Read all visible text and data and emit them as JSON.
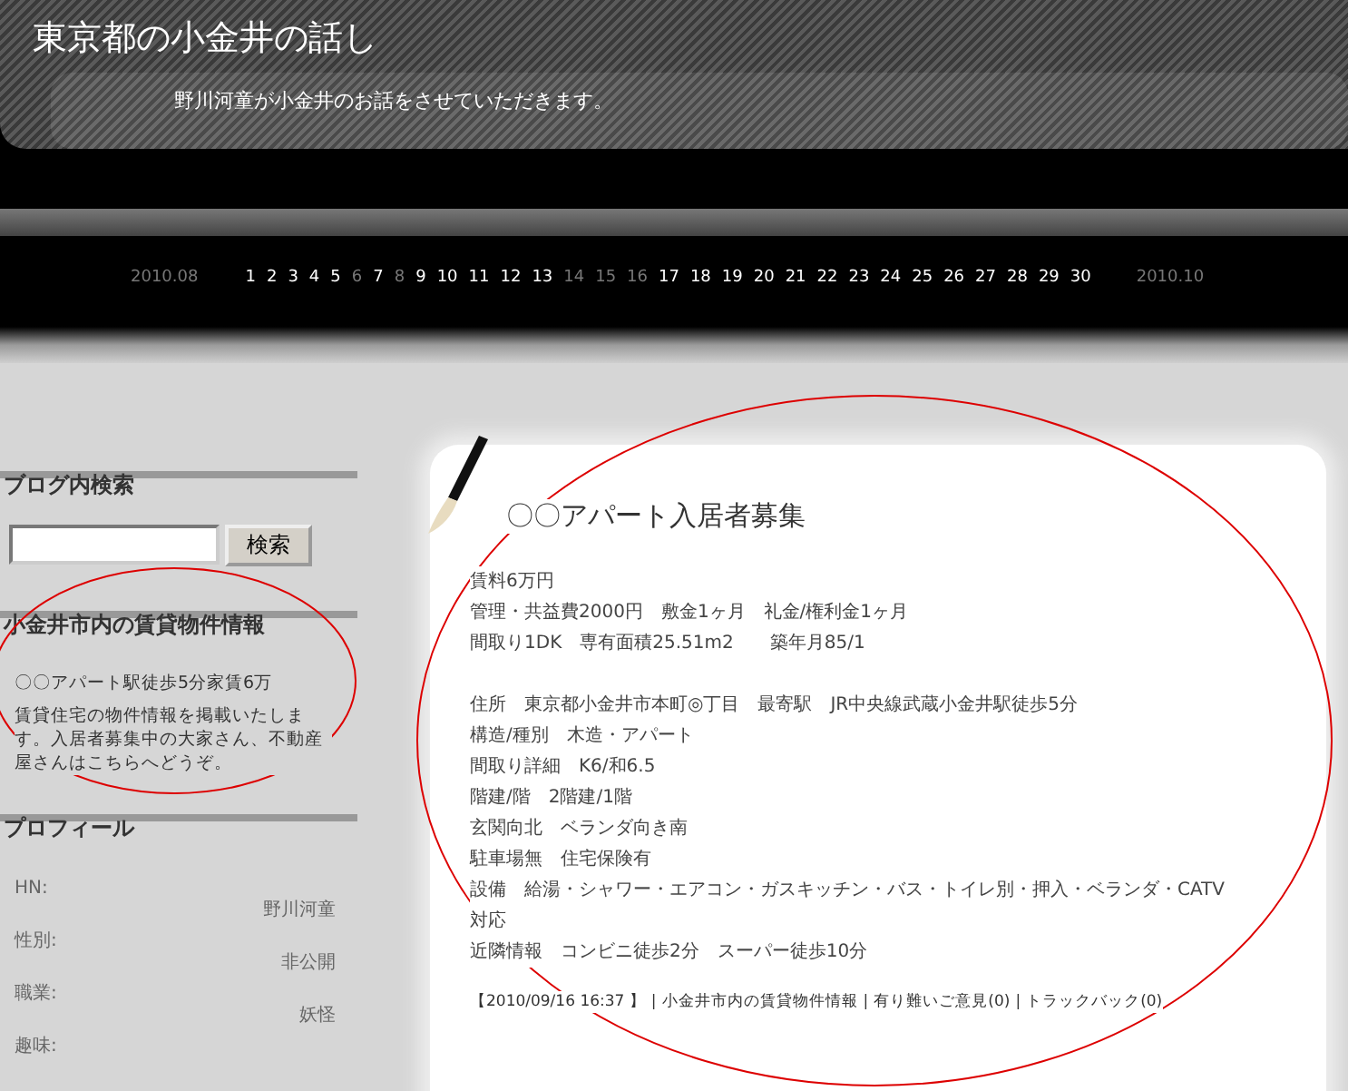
{
  "header": {
    "title": "東京都の小金井の話し",
    "subtitle": "野川河童が小金井のお話をさせていただきます。"
  },
  "calendar": {
    "prev": "2010.08",
    "next": "2010.10",
    "days": [
      {
        "label": "1",
        "has_post": true
      },
      {
        "label": "2",
        "has_post": true
      },
      {
        "label": "3",
        "has_post": true
      },
      {
        "label": "4",
        "has_post": true
      },
      {
        "label": "5",
        "has_post": true
      },
      {
        "label": "6",
        "has_post": false
      },
      {
        "label": "7",
        "has_post": true
      },
      {
        "label": "8",
        "has_post": false
      },
      {
        "label": "9",
        "has_post": true
      },
      {
        "label": "10",
        "has_post": true
      },
      {
        "label": "11",
        "has_post": true
      },
      {
        "label": "12",
        "has_post": true
      },
      {
        "label": "13",
        "has_post": true
      },
      {
        "label": "14",
        "has_post": false
      },
      {
        "label": "15",
        "has_post": false
      },
      {
        "label": "16",
        "has_post": false
      },
      {
        "label": "17",
        "has_post": true
      },
      {
        "label": "18",
        "has_post": true
      },
      {
        "label": "19",
        "has_post": true
      },
      {
        "label": "20",
        "has_post": true
      },
      {
        "label": "21",
        "has_post": true
      },
      {
        "label": "22",
        "has_post": true
      },
      {
        "label": "23",
        "has_post": true
      },
      {
        "label": "24",
        "has_post": true
      },
      {
        "label": "25",
        "has_post": true
      },
      {
        "label": "26",
        "has_post": true
      },
      {
        "label": "27",
        "has_post": true
      },
      {
        "label": "28",
        "has_post": true
      },
      {
        "label": "29",
        "has_post": true
      },
      {
        "label": "30",
        "has_post": true
      }
    ]
  },
  "sidebar": {
    "search": {
      "heading": "ブログ内検索",
      "button": "検索"
    },
    "category": {
      "heading": "小金井市内の賃貸物件情報",
      "link": "〇〇アパート駅徒歩5分家賃6万",
      "description": "賃貸住宅の物件情報を掲載いたします。入居者募集中の大家さん、不動産屋さんはこちらへどうぞ。"
    },
    "profile": {
      "heading": "プロフィール",
      "fields": [
        {
          "label": "HN:",
          "value": "野川河童"
        },
        {
          "label": "性別:",
          "value": "非公開"
        },
        {
          "label": "職業:",
          "value": "妖怪"
        },
        {
          "label": "趣味:"
        }
      ]
    }
  },
  "post": {
    "title": "〇〇アパート入居者募集",
    "paragraphs": [
      [
        "賃料6万円",
        "管理・共益費2000円　敷金1ヶ月　礼金/権利金1ヶ月",
        "間取り1DK　専有面積25.51m2　　築年月85/1"
      ],
      [
        "住所　東京都小金井市本町◎丁目　最寄駅　JR中央線武蔵小金井駅徒歩5分",
        "構造/種別　木造・アパート",
        "間取り詳細　K6/和6.5",
        "階建/階　2階建/1階",
        "玄関向北　ベランダ向き南",
        "駐車場無　住宅保険有",
        "設備　給湯・シャワー・エアコン・ガスキッチン・バス・トイレ別・押入・ベランダ・CATV",
        "対応",
        "近隣情報　コンビニ徒歩2分　スーパー徒歩10分"
      ]
    ],
    "meta": [
      {
        "kind": "date",
        "text": "【2010/09/16 16:37 】"
      },
      {
        "kind": "separator",
        "text": "|"
      },
      {
        "kind": "link",
        "text": "小金井市内の賃貸物件情報"
      },
      {
        "kind": "separator",
        "text": "|"
      },
      {
        "kind": "link",
        "text": "有り難いご意見(0)"
      },
      {
        "kind": "separator",
        "text": "|"
      },
      {
        "kind": "link",
        "text": "トラックバック(0)"
      }
    ]
  }
}
